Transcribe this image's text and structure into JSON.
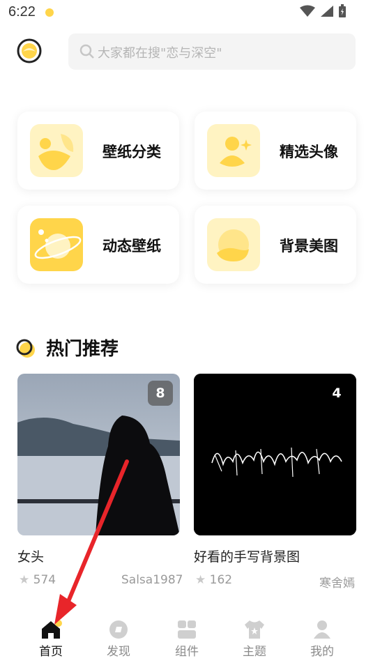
{
  "status": {
    "time": "6:22"
  },
  "search": {
    "placeholder": "大家都在搜\"恋与深空\""
  },
  "categories": [
    {
      "label": "壁纸分类",
      "icon": "wallpaper-category-icon"
    },
    {
      "label": "精选头像",
      "icon": "avatar-icon"
    },
    {
      "label": "动态壁纸",
      "icon": "planet-icon"
    },
    {
      "label": "背景美图",
      "icon": "chat-bubble-icon"
    }
  ],
  "section": {
    "title": "热门推荐"
  },
  "posts": [
    {
      "title": "女头",
      "count": "8",
      "likes": "574",
      "author": "Salsa1987"
    },
    {
      "title": "好看的手写背景图",
      "count": "4",
      "likes": "162",
      "author": "寒舍嫣"
    }
  ],
  "tabs": [
    {
      "label": "首页",
      "icon": "home-icon"
    },
    {
      "label": "发现",
      "icon": "discover-icon"
    },
    {
      "label": "组件",
      "icon": "widgets-icon"
    },
    {
      "label": "主题",
      "icon": "theme-shirt-icon"
    },
    {
      "label": "我的",
      "icon": "profile-icon"
    }
  ],
  "colors": {
    "accent": "#FFD54A",
    "accent_light": "#FFF3C2",
    "arrow": "#E8252A"
  }
}
